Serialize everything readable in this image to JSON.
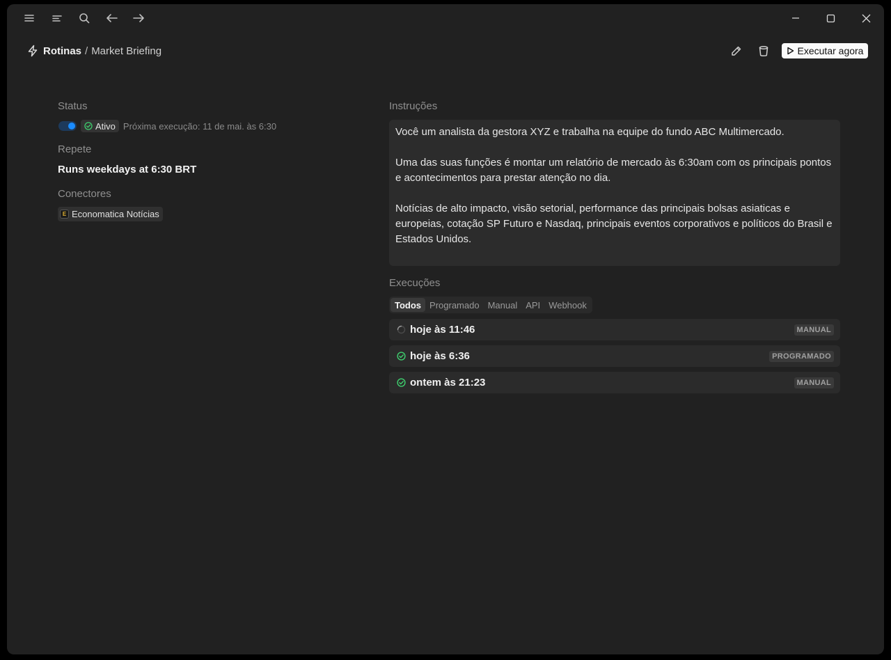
{
  "titlebar": {
    "icons": [
      "menu-icon",
      "outline-icon",
      "search-icon",
      "back-arrow-icon",
      "forward-arrow-icon"
    ],
    "window_controls": [
      "minimize-icon",
      "maximize-icon",
      "close-icon"
    ]
  },
  "header": {
    "breadcrumb_root": "Rotinas",
    "breadcrumb_sep": "/",
    "breadcrumb_page": "Market Briefing",
    "run_now_label": "Executar agora",
    "actions": [
      "pencil-icon",
      "trash-icon"
    ]
  },
  "details": {
    "status_label": "Status",
    "status_value": "Ativo",
    "status_enabled": true,
    "next_run": "Próxima execução: 11 de mai. às 6:30",
    "repeat_label": "Repete",
    "repeat_value": "Runs weekdays at 6:30 BRT",
    "connectors_label": "Conectores",
    "connector_logo_letter": "E",
    "connector_name": "Economatica Notícias"
  },
  "instructions": {
    "label": "Instruções",
    "paragraphs": [
      "Você um analista da gestora XYZ e trabalha na equipe do fundo ABC Multimercado.",
      "Uma das suas funções é montar um relatório de mercado às 6:30am com os principais pontos e acontecimentos para prestar atenção no dia.",
      "Notícias de alto impacto, visão setorial, performance das principais bolsas asiaticas e europeias, cotação SP Futuro e Nasdaq, principais eventos corporativos e políticos do Brasil e Estados Unidos."
    ]
  },
  "executions": {
    "label": "Execuções",
    "tabs": [
      "Todos",
      "Programado",
      "Manual",
      "API",
      "Webhook"
    ],
    "active_tab": "Todos",
    "rows": [
      {
        "time": "hoje às 11:46",
        "tag": "MANUAL",
        "state": "running",
        "icon": "spinner-icon"
      },
      {
        "time": "hoje às 6:36",
        "tag": "PROGRAMADO",
        "state": "success",
        "icon": "check-circle-icon"
      },
      {
        "time": "ontem às 21:23",
        "tag": "MANUAL",
        "state": "success",
        "icon": "check-circle-icon"
      }
    ]
  },
  "colors": {
    "background": "#212121",
    "accent_blue": "#1a8cff",
    "success_green": "#3ecf6e"
  }
}
